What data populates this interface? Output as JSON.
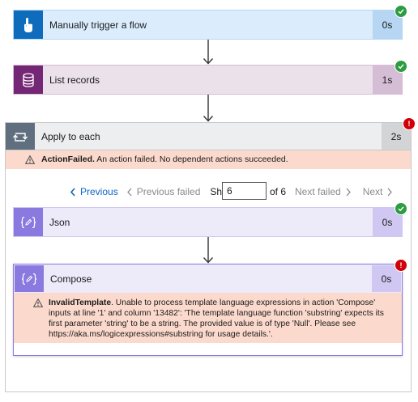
{
  "steps": {
    "trigger": {
      "title": "Manually trigger a flow",
      "duration": "0s",
      "status": "success"
    },
    "list_records": {
      "title": "List records",
      "duration": "1s",
      "status": "success"
    },
    "apply_each": {
      "title": "Apply to each",
      "duration": "2s",
      "status": "failed",
      "error_code": "ActionFailed.",
      "error_message": " An action failed. No dependent actions succeeded."
    },
    "json": {
      "title": "Json",
      "duration": "0s",
      "status": "success"
    },
    "compose": {
      "title": "Compose",
      "duration": "0s",
      "status": "failed",
      "error_code": "InvalidTemplate",
      "error_message": ". Unable to process template language expressions in action 'Compose' inputs at line '1' and column '13482': 'The template language function 'substring' expects its first parameter 'string' to be a string. The provided value is of type 'Null'. Please see https://aka.ms/logicexpressions#substring for usage details.'."
    }
  },
  "pager": {
    "previous": "Previous",
    "previous_failed": "Previous failed",
    "show_label": "Show",
    "current": "6",
    "of_total": "of 6",
    "next_failed": "Next failed",
    "next": "Next"
  },
  "colors": {
    "trigger": "#0f6cbd",
    "dataverse": "#742774",
    "control": "#5f6f7f",
    "compose": "#8a7ae0",
    "success": "#2e9c42",
    "error": "#d0000a",
    "link": "#0f66c0"
  }
}
